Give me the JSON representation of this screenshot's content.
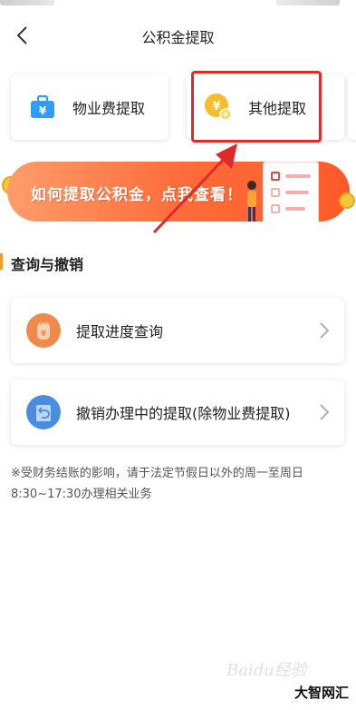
{
  "nav": {
    "title": "公积金提取"
  },
  "cards": [
    {
      "label": "物业费提取",
      "icon": "briefcase-icon",
      "color": "#2f9cf5"
    },
    {
      "label": "其他提取",
      "icon": "yen-coin-icon",
      "color": "#f4be2a"
    }
  ],
  "banner": {
    "text": "如何提取公积金，点我查看！"
  },
  "section": {
    "title": "查询与撤销"
  },
  "list": [
    {
      "label": "提取进度查询",
      "icon": "progress-query-icon",
      "color": "#f08a4b"
    },
    {
      "label": "撤销办理中的提取(除物业费提取)",
      "icon": "revoke-icon",
      "color": "#4a8ce0"
    }
  ],
  "note": {
    "line1": "※受财务结账的影响，请于法定节假日以外的周一至周日",
    "line2": "8:30~17:30办理相关业务"
  },
  "watermark": "Baidu经验",
  "brand": "大智网汇",
  "colors": {
    "accent": "#f39b2c",
    "highlight": "#e02a2a",
    "banner": "#ff6d3a"
  }
}
